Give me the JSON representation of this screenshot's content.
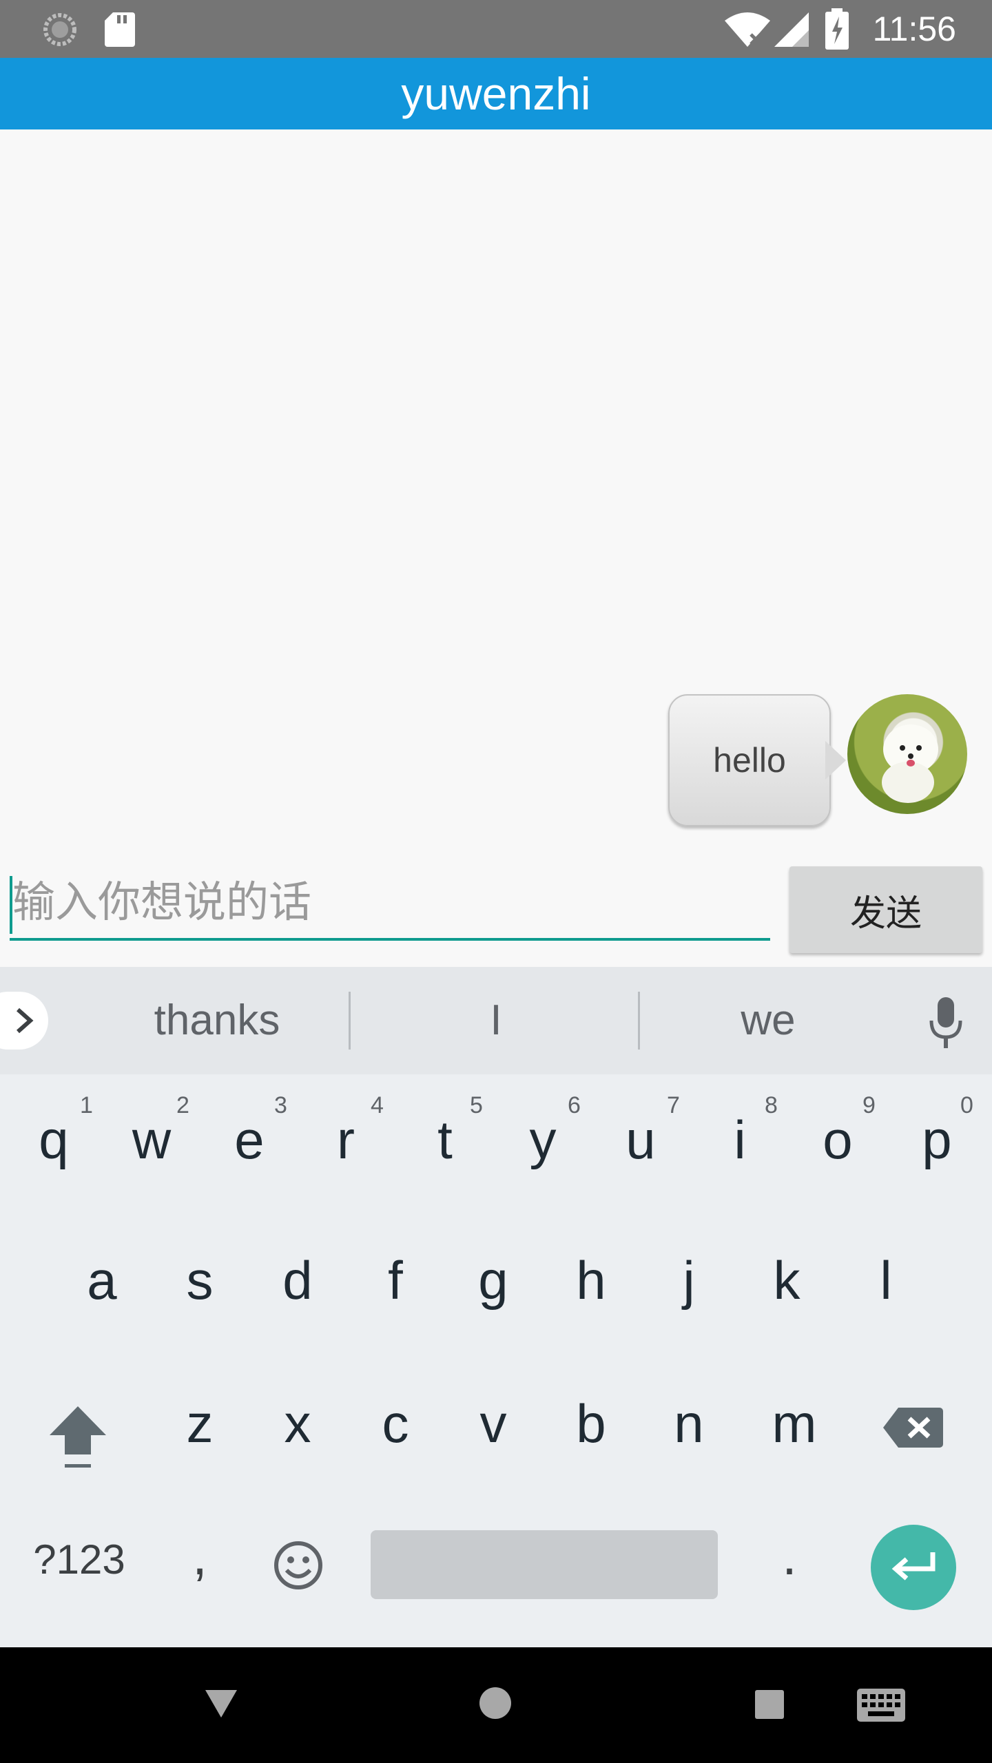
{
  "status_bar": {
    "time": "11:56"
  },
  "app_bar": {
    "title": "yuwenzhi"
  },
  "chat": {
    "messages": [
      {
        "text": "hello",
        "side": "right"
      }
    ]
  },
  "composer": {
    "placeholder": "输入你想说的话",
    "send_label": "发送"
  },
  "keyboard": {
    "suggestions": [
      "thanks",
      "I",
      "we"
    ],
    "row1": [
      {
        "key": "q",
        "hint": "1"
      },
      {
        "key": "w",
        "hint": "2"
      },
      {
        "key": "e",
        "hint": "3"
      },
      {
        "key": "r",
        "hint": "4"
      },
      {
        "key": "t",
        "hint": "5"
      },
      {
        "key": "y",
        "hint": "6"
      },
      {
        "key": "u",
        "hint": "7"
      },
      {
        "key": "i",
        "hint": "8"
      },
      {
        "key": "o",
        "hint": "9"
      },
      {
        "key": "p",
        "hint": "0"
      }
    ],
    "row2": [
      "a",
      "s",
      "d",
      "f",
      "g",
      "h",
      "j",
      "k",
      "l"
    ],
    "row3": [
      "z",
      "x",
      "c",
      "v",
      "b",
      "n",
      "m"
    ],
    "symbols_label": "?123",
    "comma_label": ",",
    "period_label": "."
  },
  "colors": {
    "app_bar": "#1296db",
    "status_bar": "#757575",
    "accent": "#0f9b8e",
    "enter_key": "#44b8a9"
  }
}
